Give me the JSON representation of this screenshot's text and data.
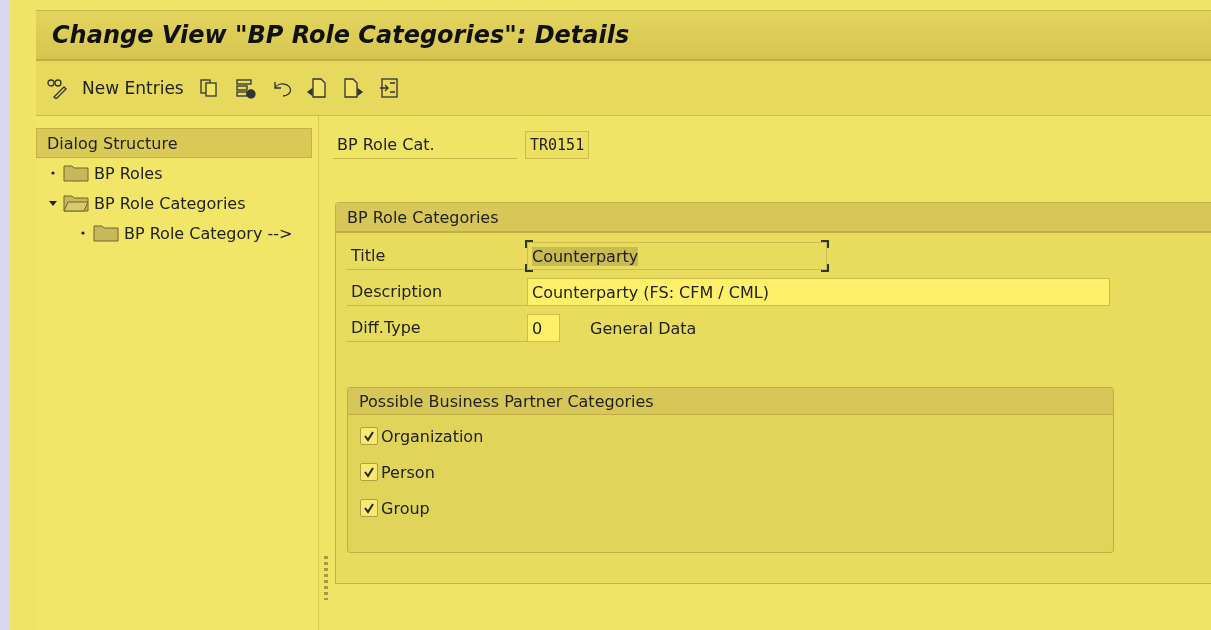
{
  "window": {
    "title": "Change View \"BP Role Categories\": Details"
  },
  "toolbar": {
    "new_entries": "New Entries"
  },
  "dialog_structure": {
    "title": "Dialog Structure",
    "items": [
      {
        "label": "BP Roles",
        "expanded": false
      },
      {
        "label": "BP Role Categories",
        "expanded": true,
        "children": [
          {
            "label": "BP Role Category -->",
            "expanded": false
          }
        ]
      }
    ]
  },
  "key_field": {
    "label": "BP Role Cat.",
    "value": "TR0151"
  },
  "details": {
    "title": "BP Role Categories",
    "fields": [
      {
        "label": "Title",
        "value": "Counterparty",
        "focused": true
      },
      {
        "label": "Description",
        "value": "Counterparty (FS: CFM / CML)",
        "focused": false
      },
      {
        "label": "Diff.Type",
        "value": "0",
        "focused": false,
        "description": "General Data"
      }
    ]
  },
  "categories": {
    "title": "Possible Business Partner Categories",
    "options": [
      {
        "label": "Organization",
        "checked": true
      },
      {
        "label": "Person",
        "checked": true
      },
      {
        "label": "Group",
        "checked": true
      }
    ]
  }
}
